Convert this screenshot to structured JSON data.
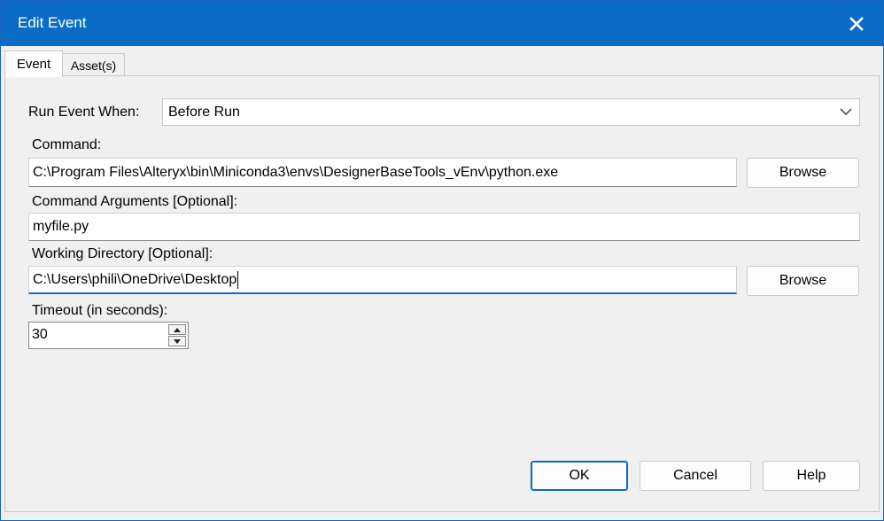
{
  "window": {
    "title": "Edit Event",
    "close_icon": "close-icon"
  },
  "tabs": [
    {
      "label": "Event",
      "active": true
    },
    {
      "label": "Asset(s)",
      "active": false
    }
  ],
  "form": {
    "run_event_when": {
      "label": "Run Event When:",
      "value": "Before Run"
    },
    "command": {
      "label": "Command:",
      "value": "C:\\Program Files\\Alteryx\\bin\\Miniconda3\\envs\\DesignerBaseTools_vEnv\\python.exe",
      "browse_label": "Browse"
    },
    "command_arguments": {
      "label": "Command Arguments [Optional]:",
      "value": "myfile.py"
    },
    "working_directory": {
      "label": "Working Directory [Optional]:",
      "value": "C:\\Users\\phili\\OneDrive\\Desktop",
      "browse_label": "Browse"
    },
    "timeout": {
      "label": "Timeout (in seconds):",
      "value": "30"
    }
  },
  "buttons": {
    "ok": "OK",
    "cancel": "Cancel",
    "help": "Help"
  },
  "colors": {
    "titlebar": "#0b6cc6",
    "focus_accent": "#0b6cc6"
  }
}
